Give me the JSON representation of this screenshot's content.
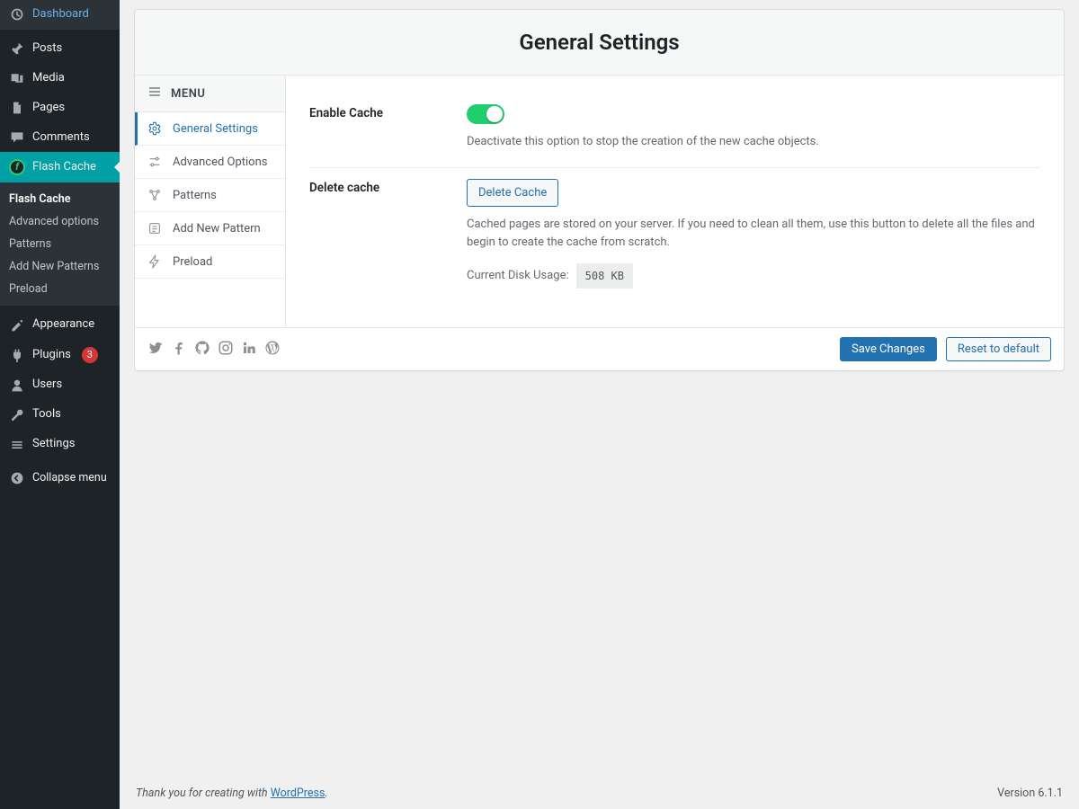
{
  "sidebar": {
    "items": [
      {
        "id": "dashboard",
        "label": "Dashboard"
      },
      {
        "id": "posts",
        "label": "Posts"
      },
      {
        "id": "media",
        "label": "Media"
      },
      {
        "id": "pages",
        "label": "Pages"
      },
      {
        "id": "comments",
        "label": "Comments"
      },
      {
        "id": "flash-cache",
        "label": "Flash Cache"
      },
      {
        "id": "appearance",
        "label": "Appearance"
      },
      {
        "id": "plugins",
        "label": "Plugins",
        "badge": "3"
      },
      {
        "id": "users",
        "label": "Users"
      },
      {
        "id": "tools",
        "label": "Tools"
      },
      {
        "id": "settings",
        "label": "Settings"
      }
    ],
    "flash_submenu": [
      {
        "label": "Flash Cache",
        "current": true
      },
      {
        "label": "Advanced options"
      },
      {
        "label": "Patterns"
      },
      {
        "label": "Add New Patterns"
      },
      {
        "label": "Preload"
      }
    ],
    "collapse_label": "Collapse menu"
  },
  "panel": {
    "title": "General Settings",
    "menu_heading": "MENU",
    "nav": [
      {
        "label": "General Settings",
        "active": true
      },
      {
        "label": "Advanced Options"
      },
      {
        "label": "Patterns"
      },
      {
        "label": "Add New Pattern"
      },
      {
        "label": "Preload"
      }
    ]
  },
  "settings": {
    "enable_cache": {
      "label": "Enable Cache",
      "hint": "Deactivate this option to stop the creation of the new cache objects.",
      "value": true
    },
    "delete_cache": {
      "label": "Delete cache",
      "button": "Delete Cache",
      "hint": "Cached pages are stored on your server. If you need to clean all them, use this button to delete all the files and begin to create the cache from scratch.",
      "disk_label": "Current Disk Usage:",
      "disk_value": "508 KB"
    }
  },
  "footer_actions": {
    "save": "Save Changes",
    "reset": "Reset to default"
  },
  "wp_footer": {
    "thanks": "Thank you for creating with ",
    "link_text": "WordPress",
    "period": ".",
    "version": "Version 6.1.1"
  }
}
